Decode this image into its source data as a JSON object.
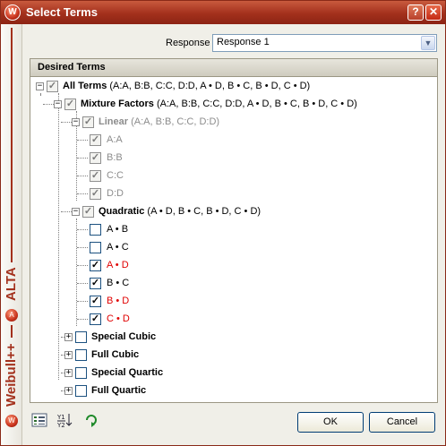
{
  "window": {
    "title": "Select Terms",
    "help_glyph": "?",
    "close_glyph": "✕",
    "logo_glyph": "W"
  },
  "sidebar": {
    "product_alta": "ALTA",
    "product_weibull": "Weibull++",
    "alta_logo_glyph": "A",
    "weibull_logo_glyph": "W"
  },
  "response": {
    "label": "Response",
    "value": "Response 1"
  },
  "panel": {
    "title": "Desired Terms"
  },
  "tree": {
    "all_terms": {
      "label": "All Terms",
      "detail": "(A:A, B:B, C:C, D:D, A • D, B • C, B • D, C • D)",
      "state": "partial"
    },
    "mixture_factors": {
      "label": "Mixture Factors",
      "detail": "(A:A, B:B, C:C, D:D, A • D, B • C, B • D, C • D)",
      "state": "partial"
    },
    "linear": {
      "label": "Linear",
      "detail": "(A:A, B:B, C:C, D:D)",
      "state": "checked-disabled"
    },
    "linear_items": [
      {
        "label": "A:A",
        "checked": true
      },
      {
        "label": "B:B",
        "checked": true
      },
      {
        "label": "C:C",
        "checked": true
      },
      {
        "label": "D:D",
        "checked": true
      }
    ],
    "quadratic": {
      "label": "Quadratic",
      "detail": "(A • D, B • C, B • D, C • D)",
      "state": "partial"
    },
    "quadratic_items": [
      {
        "label": "A • B",
        "checked": false,
        "color": "normal"
      },
      {
        "label": "A • C",
        "checked": false,
        "color": "normal"
      },
      {
        "label": "A • D",
        "checked": true,
        "color": "red"
      },
      {
        "label": "B • C",
        "checked": true,
        "color": "normal"
      },
      {
        "label": "B • D",
        "checked": true,
        "color": "red"
      },
      {
        "label": "C • D",
        "checked": true,
        "color": "red"
      }
    ],
    "collapsed_groups": [
      {
        "label": "Special Cubic",
        "checked": false
      },
      {
        "label": "Full Cubic",
        "checked": false
      },
      {
        "label": "Special Quartic",
        "checked": false
      },
      {
        "label": "Full Quartic",
        "checked": false
      }
    ]
  },
  "footer": {
    "ok_label": "OK",
    "cancel_label": "Cancel",
    "icons": [
      "select-list-icon",
      "fraction-sort-icon",
      "refresh-icon"
    ]
  },
  "colors": {
    "titlebar": "#a3301c",
    "accent_red": "#e00000",
    "disabled_text": "#8c8c8c"
  }
}
